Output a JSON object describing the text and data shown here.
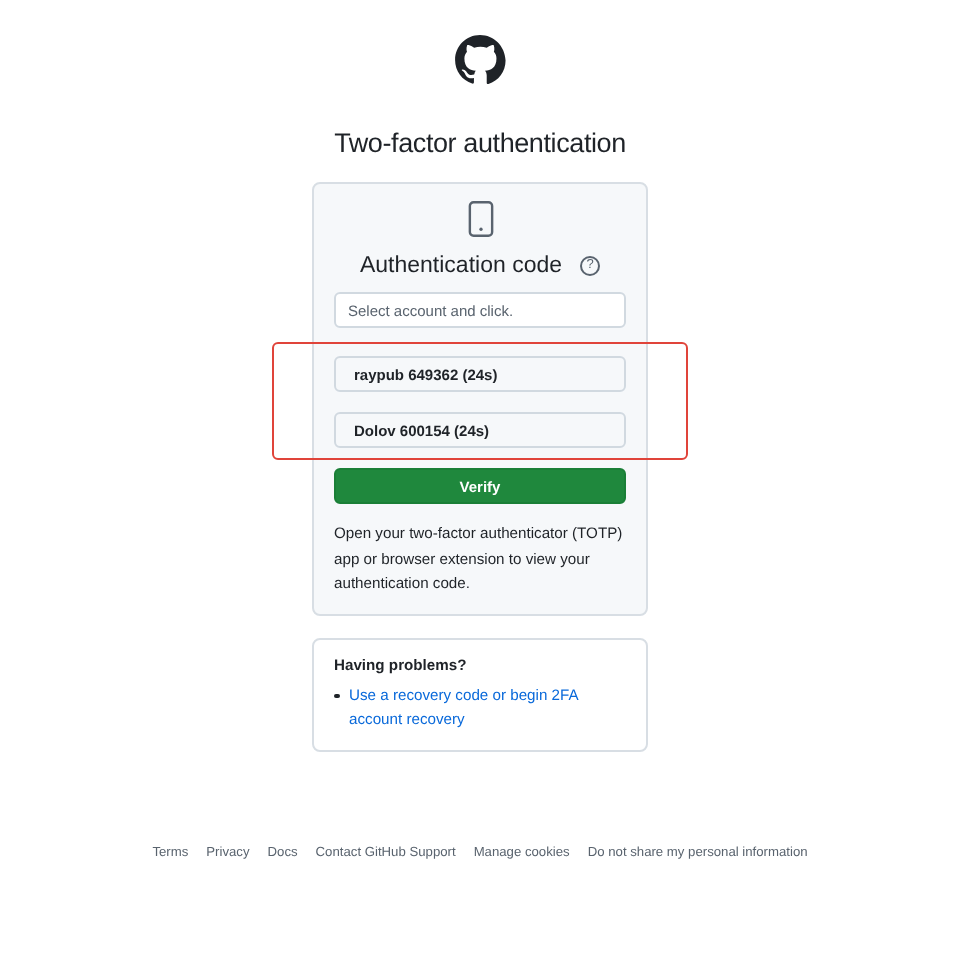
{
  "title": "Two-factor authentication",
  "auth_card": {
    "heading": "Authentication code",
    "help_icon": "?",
    "field": {
      "placeholder": "Select account and click."
    },
    "code_options_highlighted": true,
    "code_options": [
      {
        "label": "raypub 649362 (24s)"
      },
      {
        "label": "Dolov 600154 (24s)"
      }
    ],
    "verify_button": "Verify",
    "description": "Open your two-factor authenticator (TOTP) app or browser extension to view your authentication code."
  },
  "problems_card": {
    "heading": "Having problems?",
    "links": [
      "Use a recovery code or begin 2FA account recovery"
    ]
  },
  "footer_links": [
    "Terms",
    "Privacy",
    "Docs",
    "Contact GitHub Support",
    "Manage cookies",
    "Do not share my personal information"
  ]
}
